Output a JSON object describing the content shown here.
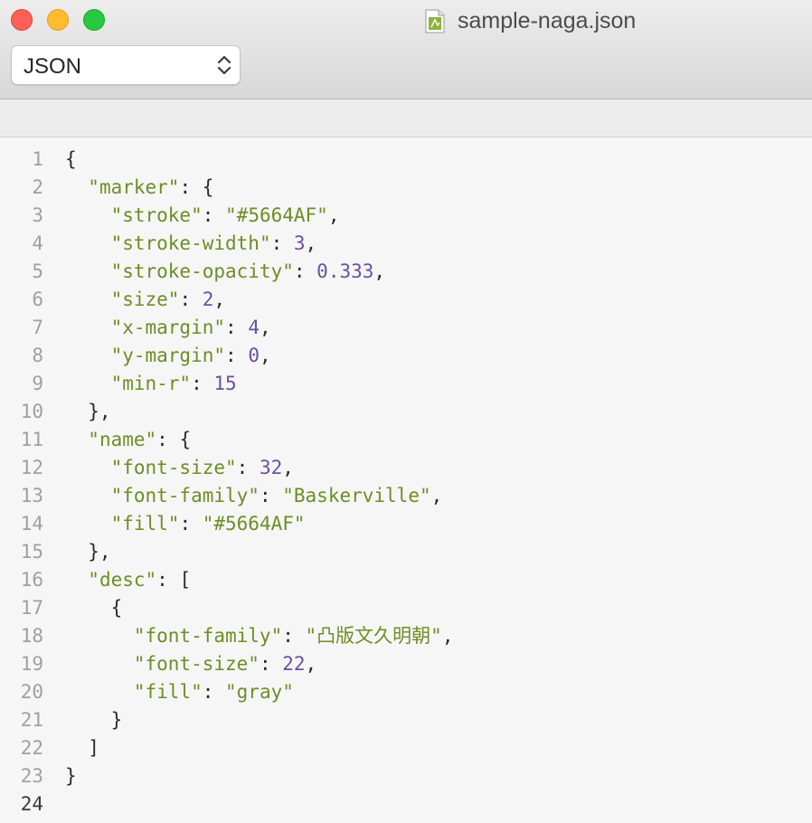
{
  "window": {
    "title": "sample-naga.json",
    "file_icon": "json-file-icon"
  },
  "toolbar": {
    "syntax_selected": "JSON"
  },
  "colors": {
    "string": "#6e8d27",
    "number": "#6c4fa3",
    "punctuation": "#2b2b2b",
    "line_number": "#a0a0a0",
    "background": "#f6f6f6"
  },
  "editor": {
    "current_line": 24,
    "lines": [
      {
        "n": "1",
        "tokens": [
          [
            "p",
            "{"
          ]
        ]
      },
      {
        "n": "2",
        "tokens": [
          [
            "p",
            "  "
          ],
          [
            "s",
            "\"marker\""
          ],
          [
            "p",
            ": {"
          ]
        ]
      },
      {
        "n": "3",
        "tokens": [
          [
            "p",
            "    "
          ],
          [
            "s",
            "\"stroke\""
          ],
          [
            "p",
            ": "
          ],
          [
            "s",
            "\"#5664AF\""
          ],
          [
            "p",
            ","
          ]
        ]
      },
      {
        "n": "4",
        "tokens": [
          [
            "p",
            "    "
          ],
          [
            "s",
            "\"stroke-width\""
          ],
          [
            "p",
            ": "
          ],
          [
            "n",
            "3"
          ],
          [
            "p",
            ","
          ]
        ]
      },
      {
        "n": "5",
        "tokens": [
          [
            "p",
            "    "
          ],
          [
            "s",
            "\"stroke-opacity\""
          ],
          [
            "p",
            ": "
          ],
          [
            "n",
            "0.333"
          ],
          [
            "p",
            ","
          ]
        ]
      },
      {
        "n": "6",
        "tokens": [
          [
            "p",
            "    "
          ],
          [
            "s",
            "\"size\""
          ],
          [
            "p",
            ": "
          ],
          [
            "n",
            "2"
          ],
          [
            "p",
            ","
          ]
        ]
      },
      {
        "n": "7",
        "tokens": [
          [
            "p",
            "    "
          ],
          [
            "s",
            "\"x-margin\""
          ],
          [
            "p",
            ": "
          ],
          [
            "n",
            "4"
          ],
          [
            "p",
            ","
          ]
        ]
      },
      {
        "n": "8",
        "tokens": [
          [
            "p",
            "    "
          ],
          [
            "s",
            "\"y-margin\""
          ],
          [
            "p",
            ": "
          ],
          [
            "n",
            "0"
          ],
          [
            "p",
            ","
          ]
        ]
      },
      {
        "n": "9",
        "tokens": [
          [
            "p",
            "    "
          ],
          [
            "s",
            "\"min-r\""
          ],
          [
            "p",
            ": "
          ],
          [
            "n",
            "15"
          ]
        ]
      },
      {
        "n": "10",
        "tokens": [
          [
            "p",
            "  },"
          ]
        ]
      },
      {
        "n": "11",
        "tokens": [
          [
            "p",
            "  "
          ],
          [
            "s",
            "\"name\""
          ],
          [
            "p",
            ": {"
          ]
        ]
      },
      {
        "n": "12",
        "tokens": [
          [
            "p",
            "    "
          ],
          [
            "s",
            "\"font-size\""
          ],
          [
            "p",
            ": "
          ],
          [
            "n",
            "32"
          ],
          [
            "p",
            ","
          ]
        ]
      },
      {
        "n": "13",
        "tokens": [
          [
            "p",
            "    "
          ],
          [
            "s",
            "\"font-family\""
          ],
          [
            "p",
            ": "
          ],
          [
            "s",
            "\"Baskerville\""
          ],
          [
            "p",
            ","
          ]
        ]
      },
      {
        "n": "14",
        "tokens": [
          [
            "p",
            "    "
          ],
          [
            "s",
            "\"fill\""
          ],
          [
            "p",
            ": "
          ],
          [
            "s",
            "\"#5664AF\""
          ]
        ]
      },
      {
        "n": "15",
        "tokens": [
          [
            "p",
            "  },"
          ]
        ]
      },
      {
        "n": "16",
        "tokens": [
          [
            "p",
            "  "
          ],
          [
            "s",
            "\"desc\""
          ],
          [
            "p",
            ": ["
          ]
        ]
      },
      {
        "n": "17",
        "tokens": [
          [
            "p",
            "    {"
          ]
        ]
      },
      {
        "n": "18",
        "tokens": [
          [
            "p",
            "      "
          ],
          [
            "s",
            "\"font-family\""
          ],
          [
            "p",
            ": "
          ],
          [
            "s",
            "\"凸版文久明朝\""
          ],
          [
            "p",
            ","
          ]
        ]
      },
      {
        "n": "19",
        "tokens": [
          [
            "p",
            "      "
          ],
          [
            "s",
            "\"font-size\""
          ],
          [
            "p",
            ": "
          ],
          [
            "n",
            "22"
          ],
          [
            "p",
            ","
          ]
        ]
      },
      {
        "n": "20",
        "tokens": [
          [
            "p",
            "      "
          ],
          [
            "s",
            "\"fill\""
          ],
          [
            "p",
            ": "
          ],
          [
            "s",
            "\"gray\""
          ]
        ]
      },
      {
        "n": "21",
        "tokens": [
          [
            "p",
            "    }"
          ]
        ]
      },
      {
        "n": "22",
        "tokens": [
          [
            "p",
            "  ]"
          ]
        ]
      },
      {
        "n": "23",
        "tokens": [
          [
            "p",
            "}"
          ]
        ]
      },
      {
        "n": "24",
        "tokens": []
      }
    ]
  }
}
